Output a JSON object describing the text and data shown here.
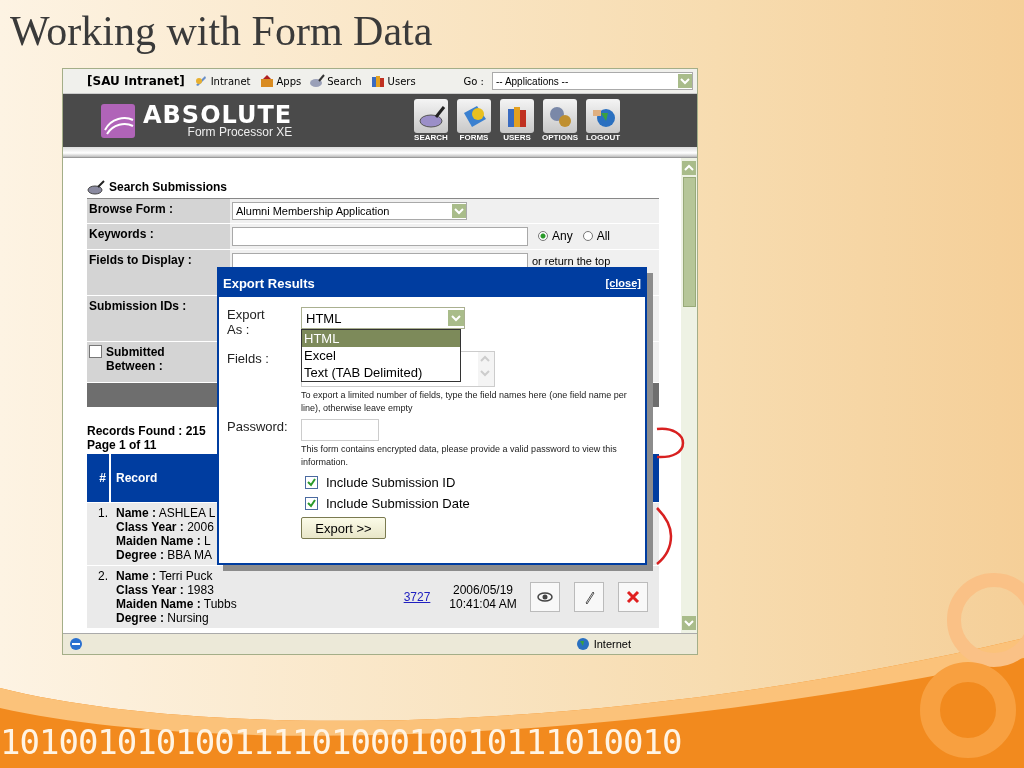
{
  "slide": {
    "title": "Working with Form Data",
    "binary_text": "10100101010011110100010010111010010"
  },
  "browser": {
    "toolbar": {
      "site": "[SAU Intranet]",
      "links": [
        {
          "label": "Intranet"
        },
        {
          "label": "Apps"
        },
        {
          "label": "Search"
        },
        {
          "label": "Users"
        }
      ],
      "go_label": "Go :",
      "go_select": "-- Applications --"
    },
    "header": {
      "logo_title": "ABSOLUTE",
      "logo_subtitle": "Form Processor XE",
      "nav": [
        {
          "label": "SEARCH"
        },
        {
          "label": "FORMS"
        },
        {
          "label": "USERS"
        },
        {
          "label": "OPTIONS"
        },
        {
          "label": "LOGOUT"
        }
      ]
    },
    "search": {
      "heading": "Search Submissions",
      "rows": [
        {
          "kind": "select",
          "label": "Browse Form :",
          "value": "Alumni Membership Application"
        },
        {
          "kind": "keywords",
          "label": "Keywords :",
          "options": [
            {
              "label": "Any",
              "selected": true
            },
            {
              "label": "All",
              "selected": false
            }
          ]
        },
        {
          "kind": "fields",
          "label": "Fields to Display :",
          "note": "or return the top"
        },
        {
          "kind": "ids",
          "label": "Submission IDs :"
        },
        {
          "kind": "date",
          "label": "Submitted Between :",
          "checked": false
        },
        {
          "kind": "bar"
        }
      ]
    },
    "records": {
      "found": "Records Found : 215",
      "page": "Page 1 of 11",
      "columns": [
        "#",
        "Record"
      ],
      "rows": [
        {
          "number": "1.",
          "fields": [
            {
              "label": "Name :",
              "value": "ASHLEA L"
            },
            {
              "label": "Class Year :",
              "value": "2006"
            },
            {
              "label": "Maiden Name :",
              "value": "L"
            },
            {
              "label": "Degree :",
              "value": "BBA MA"
            }
          ]
        },
        {
          "number": "2.",
          "fields": [
            {
              "label": "Name :",
              "value": "Terri Puck"
            },
            {
              "label": "Class Year :",
              "value": "1983"
            },
            {
              "label": "Maiden Name :",
              "value": "Tubbs"
            },
            {
              "label": "Degree :",
              "value": "Nursing"
            }
          ],
          "id": "3727",
          "date": "2006/05/19",
          "time": "10:41:04 AM"
        }
      ]
    },
    "status_bar": {
      "zone": "Internet"
    }
  },
  "dialog": {
    "title": "Export Results",
    "close": "[close]",
    "export_label": "Export As :",
    "format": {
      "value": "HTML",
      "options": [
        {
          "label": "HTML",
          "selected": true
        },
        {
          "label": "Excel",
          "selected": false
        },
        {
          "label": "Text (TAB Delimited)",
          "selected": false
        }
      ]
    },
    "fields_label": "Fields :",
    "fields_hint": "To export a limited number of fields, type the field names here (one field name per line), otherwise leave empty",
    "password_label": "Password:",
    "password_hint": "This form contains encrypted data, please provide a valid password to view this information.",
    "checks": [
      {
        "label": "Include Submission ID",
        "checked": true
      },
      {
        "label": "Include Submission Date",
        "checked": true
      }
    ],
    "button": "Export >>"
  }
}
